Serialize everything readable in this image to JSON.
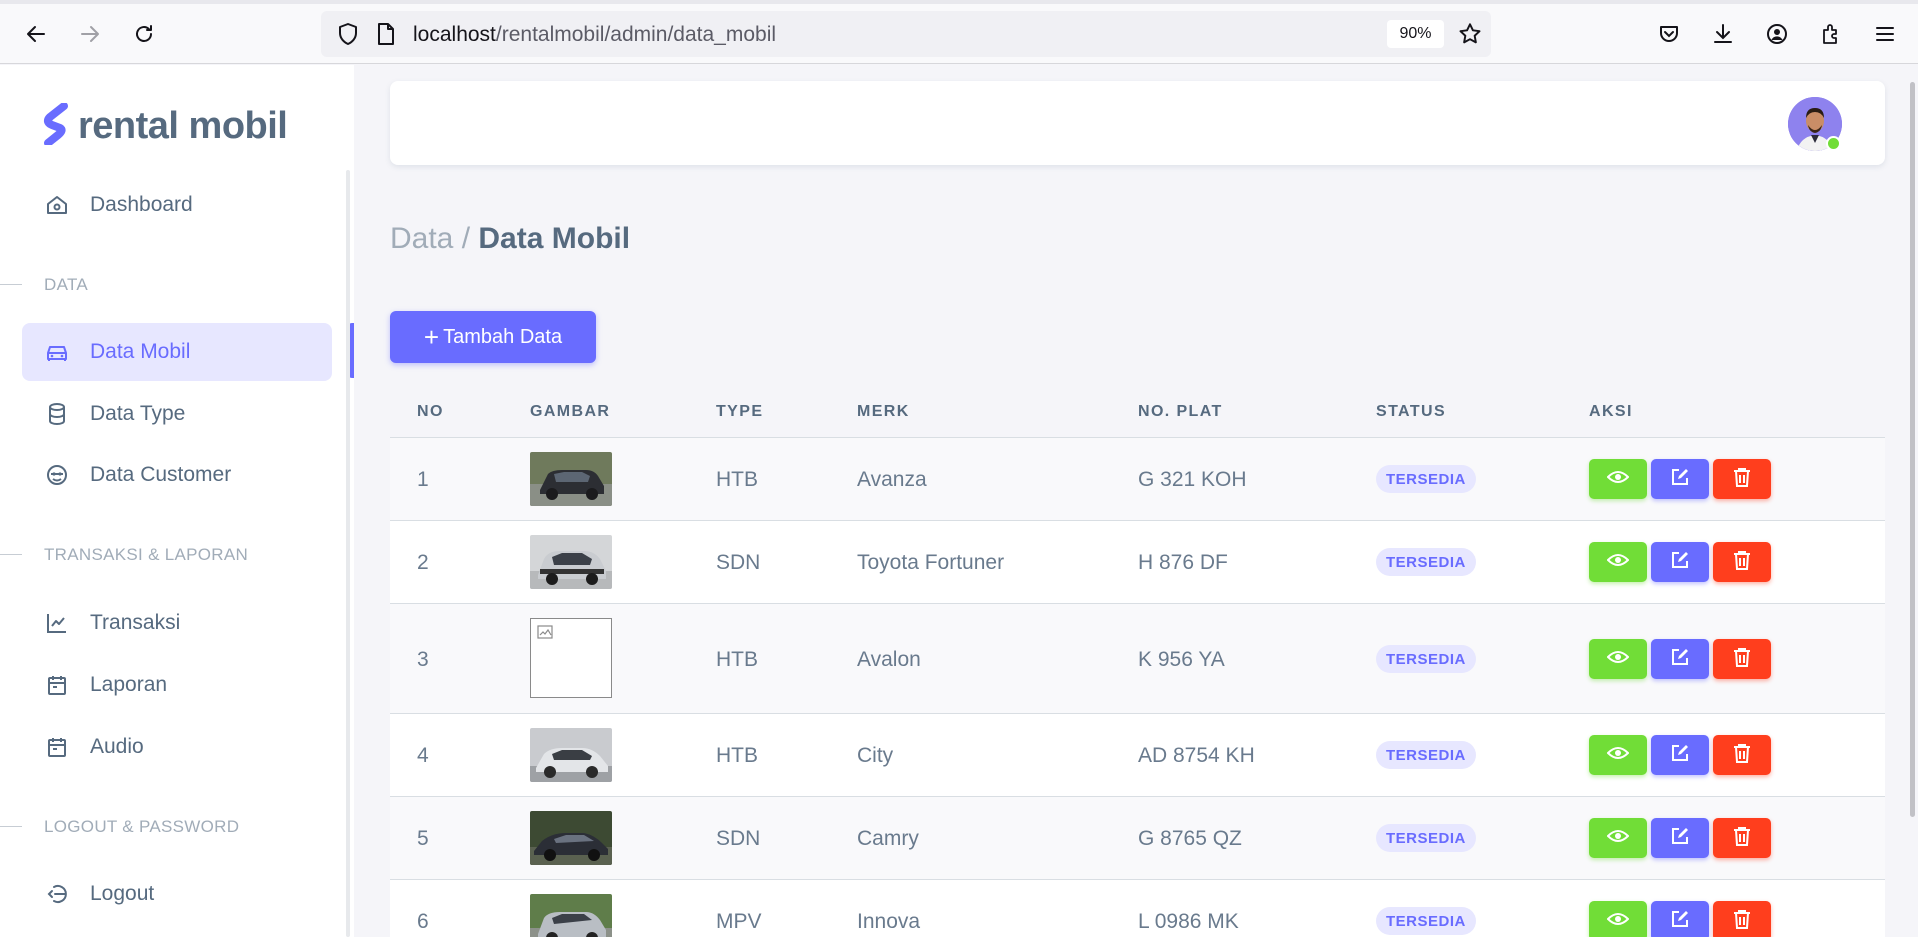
{
  "browser": {
    "url_host": "localhost",
    "url_path": "/rentalmobil/admin/data_mobil",
    "zoom": "90%"
  },
  "sidebar": {
    "brand": "rental mobil",
    "dashboard_label": "Dashboard",
    "section_data": "DATA",
    "section_transaksi": "TRANSAKSI & LAPORAN",
    "section_logout": "LOGOUT & PASSWORD",
    "items": [
      {
        "label": "Data Mobil",
        "icon": "car-icon",
        "active": true
      },
      {
        "label": "Data Type",
        "icon": "database-icon",
        "active": false
      },
      {
        "label": "Data Customer",
        "icon": "customer-icon",
        "active": false
      },
      {
        "label": "Transaksi",
        "icon": "chart-line-icon",
        "active": false
      },
      {
        "label": "Laporan",
        "icon": "calendar-icon",
        "active": false
      },
      {
        "label": "Audio",
        "icon": "calendar-icon",
        "active": false
      },
      {
        "label": "Logout",
        "icon": "logout-icon",
        "active": false
      }
    ]
  },
  "page": {
    "breadcrumb_parent": "Data /",
    "breadcrumb_current": "Data Mobil",
    "add_button": "Tambah Data"
  },
  "table": {
    "headers": [
      "NO",
      "GAMBAR",
      "TYPE",
      "MERK",
      "NO. PLAT",
      "STATUS",
      "AKSI"
    ],
    "rows": [
      {
        "no": "1",
        "type": "HTB",
        "merk": "Avanza",
        "plat": "G 321 KOH",
        "status": "TERSEDIA"
      },
      {
        "no": "2",
        "type": "SDN",
        "merk": "Toyota Fortuner",
        "plat": "H 876 DF",
        "status": "TERSEDIA"
      },
      {
        "no": "3",
        "type": "HTB",
        "merk": "Avalon",
        "plat": "K 956 YA",
        "status": "TERSEDIA"
      },
      {
        "no": "4",
        "type": "HTB",
        "merk": "City",
        "plat": "AD 8754 KH",
        "status": "TERSEDIA"
      },
      {
        "no": "5",
        "type": "SDN",
        "merk": "Camry",
        "plat": "G 8765 QZ",
        "status": "TERSEDIA"
      },
      {
        "no": "6",
        "type": "MPV",
        "merk": "Innova",
        "plat": "L 0986 MK",
        "status": "TERSEDIA"
      }
    ]
  },
  "colors": {
    "primary": "#696cff",
    "success": "#71dd37",
    "danger": "#ff3e1d",
    "text": "#566a7f",
    "muted": "#a1acb8"
  }
}
